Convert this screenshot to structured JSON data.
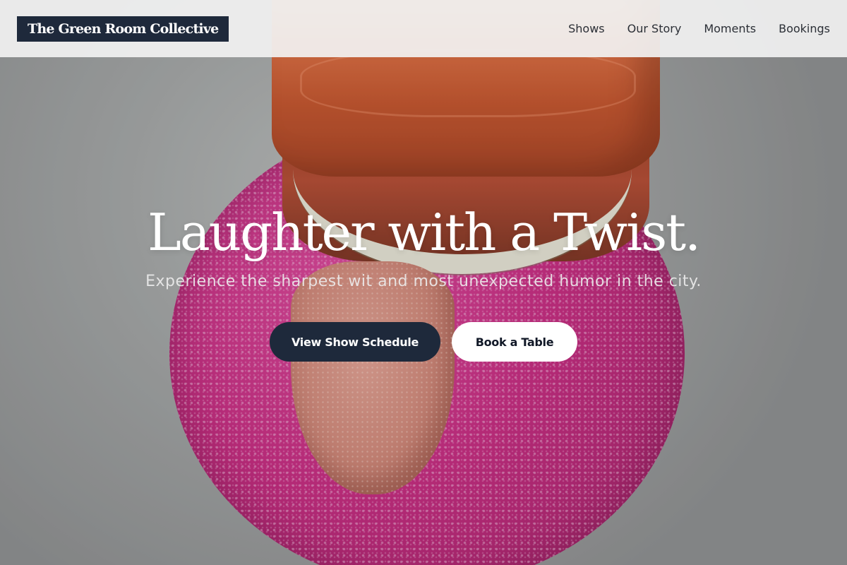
{
  "header": {
    "logo_text": "The Green Room Collective",
    "nav": [
      {
        "label": "Shows"
      },
      {
        "label": "Our Story"
      },
      {
        "label": "Moments"
      },
      {
        "label": "Bookings"
      }
    ]
  },
  "hero": {
    "headline": "Laughter with a Twist.",
    "subheadline": "Experience the sharpest wit and most unexpected humor in the city.",
    "primary_cta": "View Show Schedule",
    "secondary_cta": "Book a Table",
    "background_image": "wind-up-chattering-teeth-toy-with-tongue-on-pink-fuzzy-base"
  },
  "colors": {
    "brand_dark": "#1e293b",
    "button_light": "#ffffff",
    "header_bg": "#f2f2f2"
  }
}
